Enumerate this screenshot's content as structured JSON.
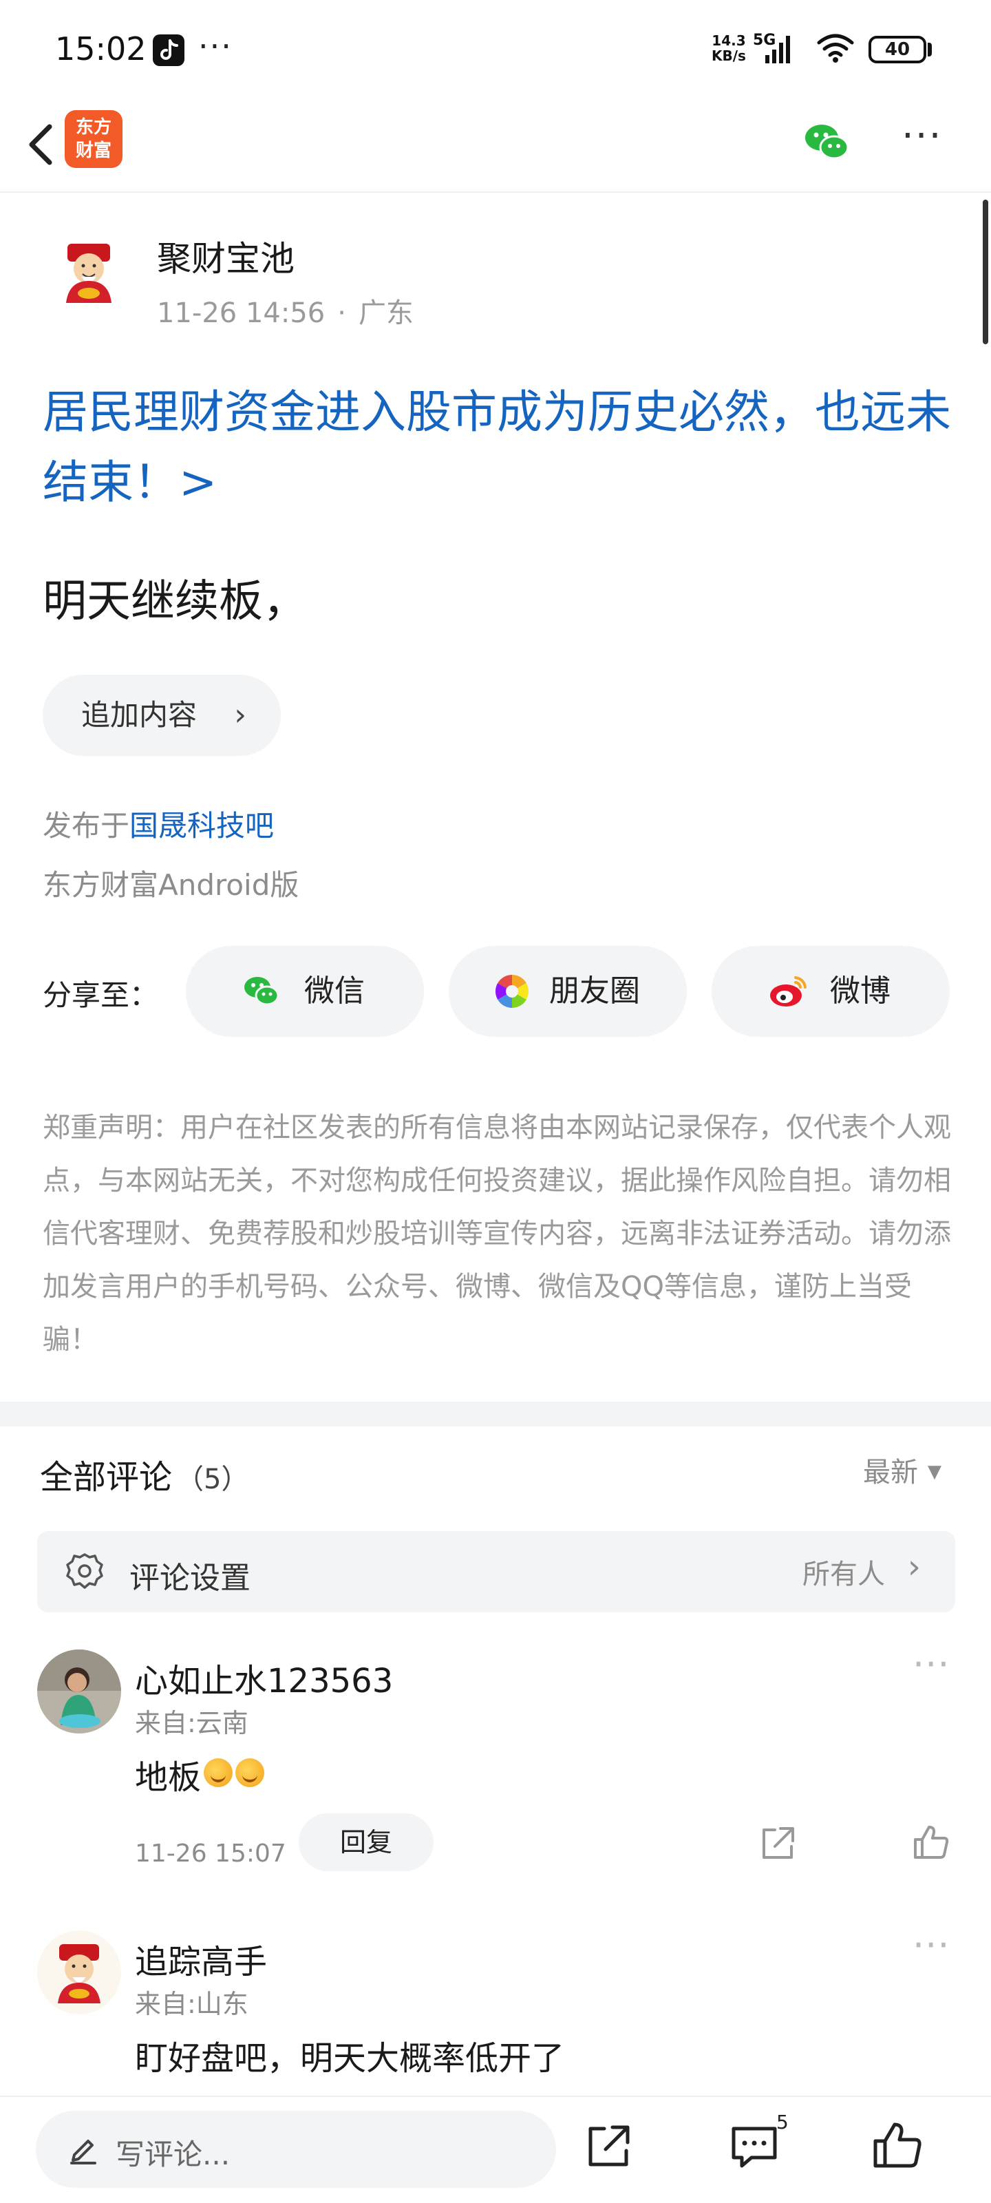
{
  "status_bar": {
    "time": "15:02",
    "more": "···",
    "net_speed_value": "14.3",
    "net_speed_unit": "KB/s",
    "network": "5G",
    "battery": "40"
  },
  "header": {
    "logo_text_line1": "东方",
    "logo_text_line2": "财富",
    "more": "···"
  },
  "post": {
    "author": "聚财宝池",
    "timestamp": "11-26 14:56",
    "separator": "·",
    "location": "广东",
    "title": "居民理财资金进入股市成为历史必然，也远未结束！>",
    "body": "明天继续板，",
    "add_content_label": "追加内容",
    "published_prefix": "发布于",
    "forum": "国晟科技吧",
    "client": "东方财富Android版"
  },
  "share": {
    "label": "分享至：",
    "targets": [
      {
        "label": "微信",
        "icon": "wechat-icon"
      },
      {
        "label": "朋友圈",
        "icon": "moments-icon"
      },
      {
        "label": "微博",
        "icon": "weibo-icon"
      }
    ]
  },
  "disclaimer": "郑重声明：用户在社区发表的所有信息将由本网站记录保存，仅代表个人观点，与本网站无关，不对您构成任何投资建议，据此操作风险自担。请勿相信代客理财、免费荐股和炒股培训等宣传内容，远离非法证券活动。请勿添加发言用户的手机号码、公众号、微博、微信及QQ等信息，谨防上当受骗！",
  "comments": {
    "title": "全部评论",
    "count": "（5）",
    "sort": "最新",
    "settings_label": "评论设置",
    "settings_value": "所有人",
    "items": [
      {
        "name": "心如止水123563",
        "location": "来自:云南",
        "text": "地板",
        "time": "11-26 15:07",
        "reply_label": "回复"
      },
      {
        "name": "追踪高手",
        "location": "来自:山东",
        "text": "盯好盘吧，明天大概率低开了"
      }
    ]
  },
  "bottom_bar": {
    "placeholder": "写评论...",
    "comment_badge": "5"
  },
  "colors": {
    "link_blue": "#1564c0",
    "brand_orange": "#f25a28",
    "wechat_green": "#2ab940",
    "weibo_red": "#e6162d",
    "pill_bg": "#f3f4f6"
  }
}
